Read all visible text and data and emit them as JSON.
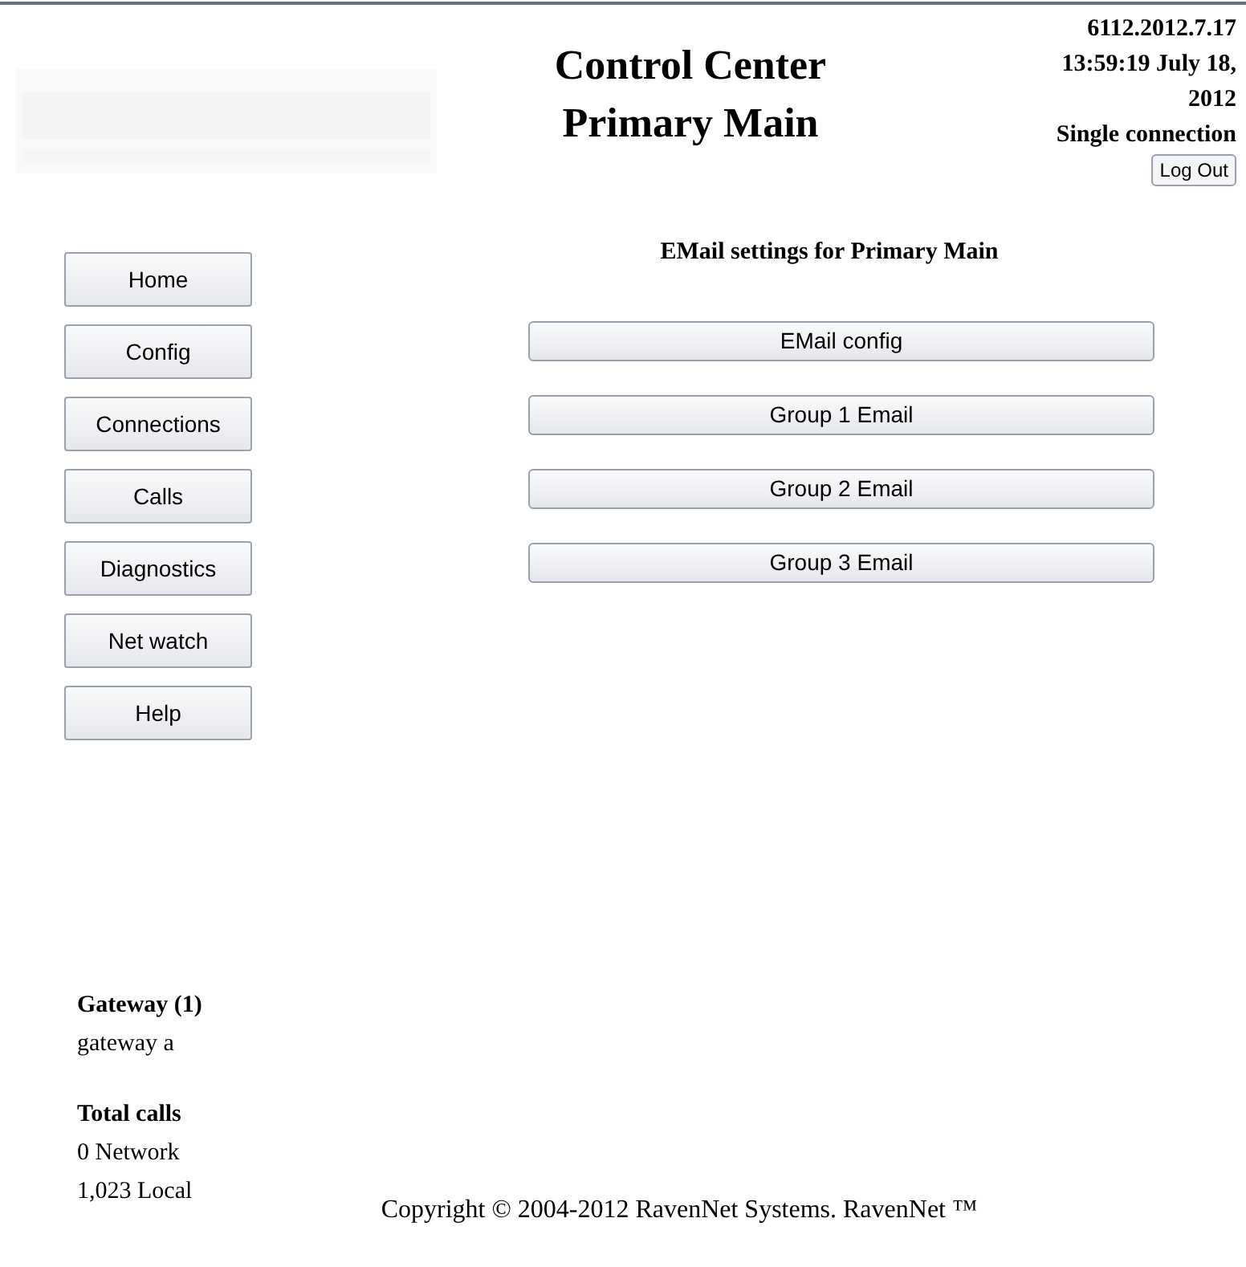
{
  "header": {
    "title_lines": [
      "Control Center",
      "Primary Main"
    ],
    "info_lines": [
      "6112.2012.7.17",
      "13:59:19 July 18,",
      "2012",
      "Single connection"
    ],
    "logout_button": "Log Out"
  },
  "sidebar": {
    "items": [
      {
        "label": "Home"
      },
      {
        "label": "Config"
      },
      {
        "label": "Connections"
      },
      {
        "label": "Calls"
      },
      {
        "label": "Diagnostics"
      },
      {
        "label": "Net watch"
      },
      {
        "label": "Help"
      }
    ]
  },
  "main": {
    "heading": "EMail settings for Primary Main",
    "buttons": [
      "EMail config",
      "Group 1 Email",
      "Group 2 Email",
      "Group 3 Email"
    ]
  },
  "gateway": {
    "title": "Gateway (1)",
    "items": [
      "gateway a"
    ]
  },
  "totals": {
    "title": "Total calls",
    "lines": [
      "0 Network",
      "1,023 Local"
    ]
  },
  "footer": "Copyright © 2004-2012 RavenNet Systems. RavenNet ™"
}
